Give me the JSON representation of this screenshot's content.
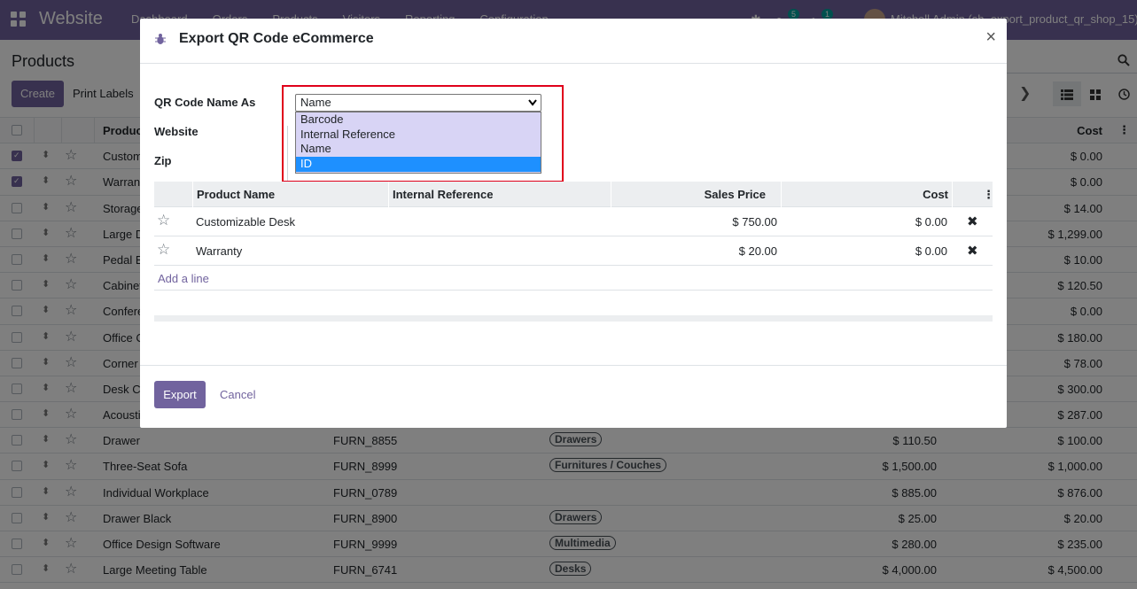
{
  "navbar": {
    "app_name": "Website",
    "menu": [
      "Dashboard",
      "Orders",
      "Products",
      "Visitors",
      "Reporting",
      "Configuration"
    ],
    "messages_count": "5",
    "activities_count": "1",
    "user": "Mitchell Admin (sh_export_product_qr_shop_15)"
  },
  "control_panel": {
    "title": "Products",
    "create_label": "Create",
    "print_label": "Print Labels"
  },
  "list": {
    "columns": {
      "name": "Product",
      "cost": "Cost"
    },
    "rows": [
      {
        "name": "Customizable Desk",
        "ref": "",
        "cat": "",
        "price": "",
        "cost": "$ 0.00",
        "checked": true
      },
      {
        "name": "Warranty",
        "ref": "",
        "cat": "",
        "price": "",
        "cost": "$ 0.00",
        "checked": true
      },
      {
        "name": "Storage Box",
        "ref": "",
        "cat": "",
        "price": "",
        "cost": "$ 14.00",
        "checked": false
      },
      {
        "name": "Large Desk",
        "ref": "",
        "cat": "",
        "price": "",
        "cost": "$ 1,299.00",
        "checked": false
      },
      {
        "name": "Pedal Bin",
        "ref": "",
        "cat": "",
        "price": "",
        "cost": "$ 10.00",
        "checked": false
      },
      {
        "name": "Cabinet with Doors",
        "ref": "",
        "cat": "",
        "price": "",
        "cost": "$ 120.50",
        "checked": false
      },
      {
        "name": "Conference Chair",
        "ref": "",
        "cat": "",
        "price": "",
        "cost": "$ 0.00",
        "checked": false
      },
      {
        "name": "Office Chair",
        "ref": "",
        "cat": "",
        "price": "",
        "cost": "$ 180.00",
        "checked": false
      },
      {
        "name": "Corner Desk",
        "ref": "",
        "cat": "",
        "price": "",
        "cost": "$ 78.00",
        "checked": false
      },
      {
        "name": "Desk Combination",
        "ref": "",
        "cat": "",
        "price": "",
        "cost": "$ 300.00",
        "checked": false
      },
      {
        "name": "Acoustic Bloc Screens",
        "ref": "",
        "cat": "",
        "price": "",
        "cost": "$ 287.00",
        "checked": false
      },
      {
        "name": "Drawer",
        "ref": "FURN_8855",
        "cat": "Drawers",
        "price": "$ 110.50",
        "cost": "$ 100.00",
        "checked": false
      },
      {
        "name": "Three-Seat Sofa",
        "ref": "FURN_8999",
        "cat": "Furnitures / Couches",
        "price": "$ 1,500.00",
        "cost": "$ 1,000.00",
        "checked": false
      },
      {
        "name": "Individual Workplace",
        "ref": "FURN_0789",
        "cat": "",
        "price": "$ 885.00",
        "cost": "$ 876.00",
        "checked": false
      },
      {
        "name": "Drawer Black",
        "ref": "FURN_8900",
        "cat": "Drawers",
        "price": "$ 25.00",
        "cost": "$ 20.00",
        "checked": false
      },
      {
        "name": "Office Design Software",
        "ref": "FURN_9999",
        "cat": "Multimedia",
        "price": "$ 280.00",
        "cost": "$ 235.00",
        "checked": false
      },
      {
        "name": "Large Meeting Table",
        "ref": "FURN_6741",
        "cat": "Desks",
        "price": "$ 4,000.00",
        "cost": "$ 4,500.00",
        "checked": false
      }
    ]
  },
  "modal": {
    "title": "Export QR Code eCommerce",
    "close_symbol": "×",
    "fields": {
      "qr_name_label": "QR Code Name As",
      "website_label": "Website",
      "zip_label": "Zip"
    },
    "select": {
      "value": "Name",
      "options": [
        "Barcode",
        "Internal Reference",
        "Name",
        "ID"
      ],
      "highlighted": "ID"
    },
    "lines": {
      "headers": [
        "Product Name",
        "Internal Reference",
        "Sales Price",
        "Cost"
      ],
      "rows": [
        {
          "name": "Customizable Desk",
          "ref": "",
          "price": "$ 750.00",
          "cost": "$ 0.00"
        },
        {
          "name": "Warranty",
          "ref": "",
          "price": "$ 20.00",
          "cost": "$ 0.00"
        }
      ],
      "add_line": "Add a line"
    },
    "footer": {
      "export_label": "Export",
      "cancel_label": "Cancel"
    }
  },
  "colors": {
    "brand": "#71639e",
    "highlight_border": "#e0001b",
    "option_selected": "#1e90ff"
  }
}
